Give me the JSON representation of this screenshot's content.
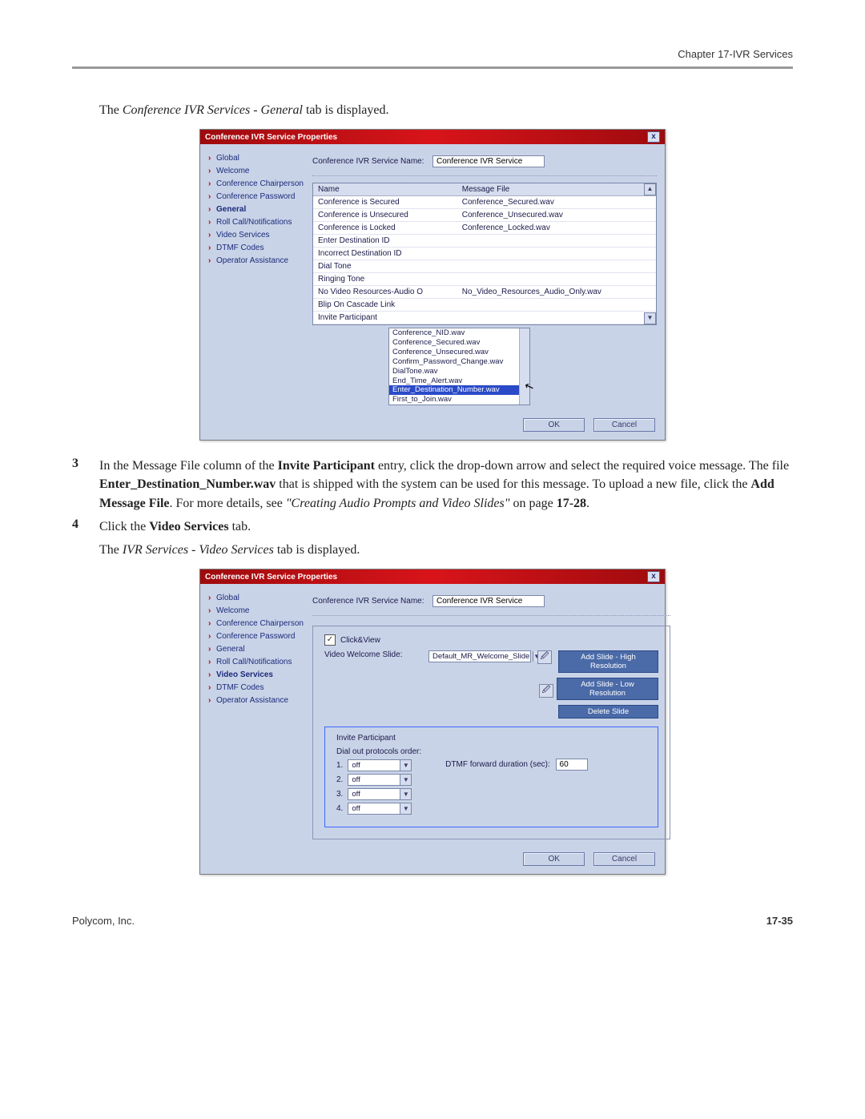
{
  "header": {
    "chapter": "Chapter 17-IVR Services"
  },
  "intro": {
    "prefix": "The ",
    "em": "Conference IVR Services - General",
    "suffix": " tab is displayed."
  },
  "dialog1": {
    "title": "Conference IVR Service Properties",
    "close": "x",
    "sidebar": [
      {
        "label": "Global",
        "active": false
      },
      {
        "label": "Welcome",
        "active": false
      },
      {
        "label": "Conference Chairperson",
        "active": false
      },
      {
        "label": "Conference Password",
        "active": false
      },
      {
        "label": "General",
        "active": true
      },
      {
        "label": "Roll Call/Notifications",
        "active": false
      },
      {
        "label": "Video Services",
        "active": false
      },
      {
        "label": "DTMF Codes",
        "active": false
      },
      {
        "label": "Operator Assistance",
        "active": false
      }
    ],
    "service_name_label": "Conference IVR Service Name:",
    "service_name_value": "Conference IVR Service",
    "table": {
      "headers": [
        "Name",
        "Message File"
      ],
      "rows": [
        [
          "Conference is Secured",
          "Conference_Secured.wav"
        ],
        [
          "Conference is Unsecured",
          "Conference_Unsecured.wav"
        ],
        [
          "Conference is Locked",
          "Conference_Locked.wav"
        ],
        [
          "Enter Destination ID",
          ""
        ],
        [
          "Incorrect Destination ID",
          ""
        ],
        [
          "Dial Tone",
          ""
        ],
        [
          "Ringing Tone",
          ""
        ],
        [
          "No Video Resources-Audio O",
          "No_Video_Resources_Audio_Only.wav"
        ],
        [
          "Blip On Cascade Link",
          ""
        ],
        [
          "Invite Participant",
          ""
        ]
      ]
    },
    "dropdown": {
      "items": [
        {
          "label": "Conference_NID.wav",
          "sel": false
        },
        {
          "label": "Conference_Secured.wav",
          "sel": false
        },
        {
          "label": "Conference_Unsecured.wav",
          "sel": false
        },
        {
          "label": "Confirm_Password_Change.wav",
          "sel": false
        },
        {
          "label": "DialTone.wav",
          "sel": false
        },
        {
          "label": "End_Time_Alert.wav",
          "sel": false
        },
        {
          "label": "Enter_Destination_Number.wav",
          "sel": true
        },
        {
          "label": "First_to_Join.wav",
          "sel": false
        }
      ]
    },
    "ok": "OK",
    "cancel": "Cancel"
  },
  "step3": {
    "num": "3",
    "t1": "In the Message File column of the ",
    "b1": "Invite Participant",
    "t2": " entry, click the drop-down arrow and select the required voice message. The file ",
    "b2": "Enter_Destination_Number.wav",
    "t3": " that is shipped with the system can be used for this message. To upload a new file, click the ",
    "b3": "Add Message File",
    "t4": ". For more details, see ",
    "i1": "\"Creating Audio Prompts and Video Slides\"",
    "t5": " on page ",
    "b4": "17-28",
    "t6": "."
  },
  "step4": {
    "num": "4",
    "t1": "Click the ",
    "b1": "Video Services",
    "t2": " tab."
  },
  "intro2": {
    "prefix": "The ",
    "em": "IVR Services - Video Services",
    "suffix": " tab is displayed."
  },
  "dialog2": {
    "title": "Conference IVR Service Properties",
    "close": "x",
    "sidebar": [
      {
        "label": "Global"
      },
      {
        "label": "Welcome"
      },
      {
        "label": "Conference Chairperson"
      },
      {
        "label": "Conference Password"
      },
      {
        "label": "General"
      },
      {
        "label": "Roll Call/Notifications"
      },
      {
        "label": "Video Services",
        "active": true
      },
      {
        "label": "DTMF Codes"
      },
      {
        "label": "Operator Assistance"
      }
    ],
    "service_name_label": "Conference IVR Service Name:",
    "service_name_value": "Conference IVR Service",
    "click_view": "Click&View",
    "welcome_slide_label": "Video Welcome Slide:",
    "welcome_slide_value": "Default_MR_Welcome_Slide",
    "add_high": "Add Slide - High Resolution",
    "add_low": "Add Slide - Low Resolution",
    "delete": "Delete Slide",
    "invite_header": "Invite Participant",
    "dial_order": "Dial out protocols order:",
    "dtmf_label": "DTMF forward duration (sec):",
    "dtmf_value": "60",
    "protocols": [
      {
        "num": "1.",
        "val": "off"
      },
      {
        "num": "2.",
        "val": "off"
      },
      {
        "num": "3.",
        "val": "off"
      },
      {
        "num": "4.",
        "val": "off"
      }
    ],
    "ok": "OK",
    "cancel": "Cancel"
  },
  "footer": {
    "left": "Polycom, Inc.",
    "right": "17-35"
  }
}
